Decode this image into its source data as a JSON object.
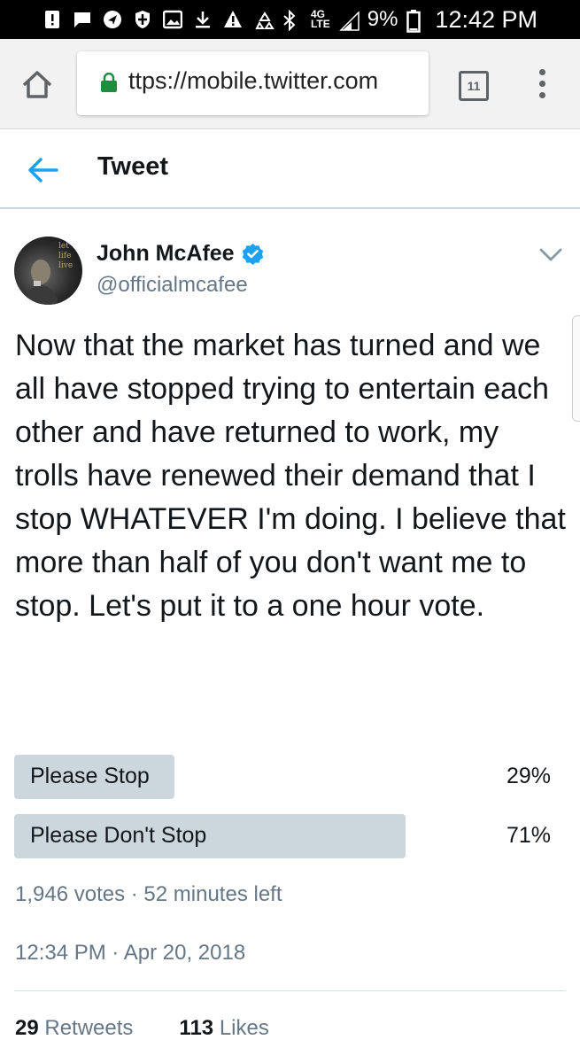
{
  "status_bar": {
    "time": "12:42 PM",
    "battery": "9%",
    "network": "4G",
    "network_sub": "LTE",
    "icons": [
      "alert-icon",
      "message-icon",
      "navigation-icon",
      "shield-icon",
      "image-icon",
      "download-icon",
      "warning-icon",
      "recycle-icon",
      "bluetooth-icon",
      "signal-icon",
      "battery-icon"
    ]
  },
  "browser": {
    "url": "ttps://mobile.twitter.com",
    "tab_count": "11",
    "lock_color": "#1e8e3e"
  },
  "header": {
    "title": "Tweet"
  },
  "author": {
    "name": "John McAfee",
    "handle": "@officialmcafee",
    "avatar_text": "let life live"
  },
  "tweet": {
    "text": "Now that the market has turned and we all have stopped trying to entertain each other and have returned to work, my trolls have renewed their demand that I stop WHATEVER I'm doing. I believe that more than half of you don't want me to stop. Let's put it to a one hour vote."
  },
  "poll": {
    "options": [
      {
        "label": "Please Stop",
        "percent_text": "29%",
        "percent": 29
      },
      {
        "label": "Please Don't Stop",
        "percent_text": "71%",
        "percent": 71
      }
    ],
    "meta": "1,946 votes · 52 minutes left"
  },
  "timestamp": "12:34 PM · Apr 20, 2018",
  "stats": {
    "retweets_count": "29",
    "retweets_label": "Retweets",
    "likes_count": "113",
    "likes_label": "Likes"
  },
  "colors": {
    "accent": "#1da1f2",
    "secondary_text": "#657786",
    "poll_bar": "#ccd6dd"
  }
}
